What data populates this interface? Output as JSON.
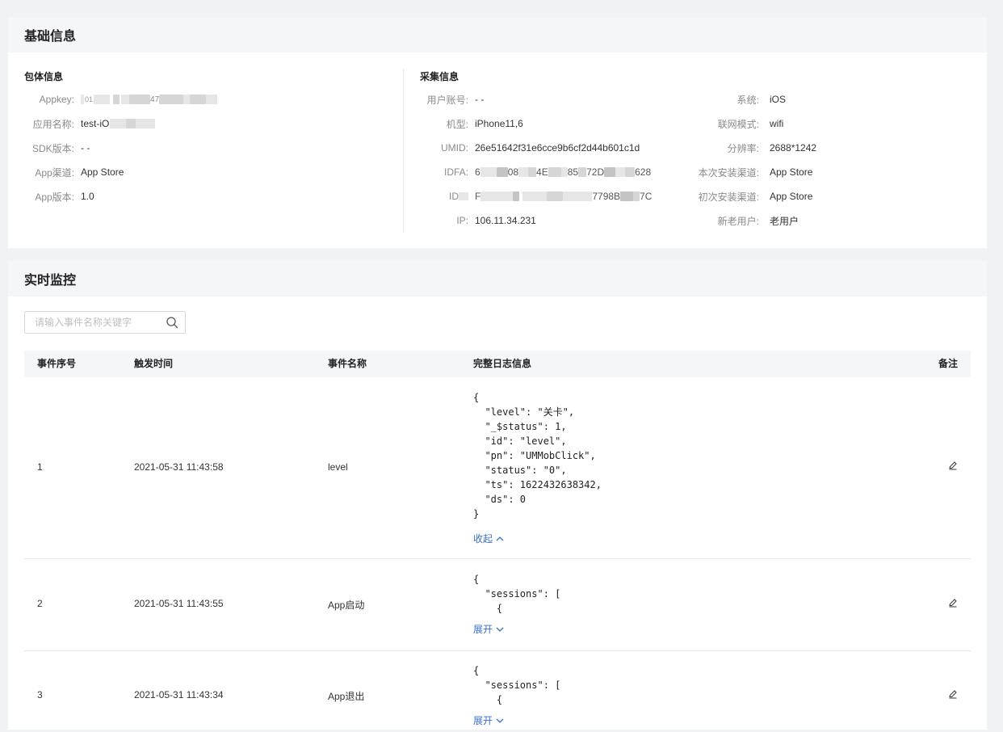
{
  "basic": {
    "title": "基础信息",
    "package": {
      "title": "包体信息",
      "rows": [
        {
          "label": "Appkey:",
          "value": ""
        },
        {
          "label": "应用名称:",
          "value": "test-iO"
        },
        {
          "label": "SDK版本:",
          "value": "- -"
        },
        {
          "label": "App渠道:",
          "value": "App Store"
        },
        {
          "label": "App版本:",
          "value": "1.0"
        }
      ]
    },
    "collect": {
      "title": "采集信息",
      "left": [
        {
          "label": "用户账号:",
          "value": "- -"
        },
        {
          "label": "机型:",
          "value": "iPhone11,6"
        },
        {
          "label": "UMID:",
          "value": "26e51642f31e6cce9b6cf2d44b601c1d"
        },
        {
          "label": "IDFA:",
          "value": ""
        },
        {
          "label": "ID",
          "value": ""
        },
        {
          "label": "IP:",
          "value": "106.11.34.231"
        }
      ],
      "right": [
        {
          "label": "系统:",
          "value": "iOS"
        },
        {
          "label": "联网模式:",
          "value": "wifi"
        },
        {
          "label": "分辨率:",
          "value": "2688*1242"
        },
        {
          "label": "本次安装渠道:",
          "value": "App Store"
        },
        {
          "label": "初次安装渠道:",
          "value": "App Store"
        },
        {
          "label": "新老用户:",
          "value": "老用户"
        }
      ]
    }
  },
  "monitor": {
    "title": "实时监控",
    "search_placeholder": "请输入事件名称关键字",
    "columns": [
      "事件序号",
      "触发时间",
      "事件名称",
      "完整日志信息",
      "备注"
    ],
    "rows": [
      {
        "index": "1",
        "time": "2021-05-31 11:43:58",
        "name": "level",
        "log": "{\n  \"level\": \"关卡\",\n  \"_$status\": 1,\n  \"id\": \"level\",\n  \"pn\": \"UMMobClick\",\n  \"status\": \"0\",\n  \"ts\": 1622432638342,\n  \"ds\": 0\n}",
        "toggle": "收起"
      },
      {
        "index": "2",
        "time": "2021-05-31 11:43:55",
        "name": "App启动",
        "log": "{\n  \"sessions\": [\n    {",
        "toggle": "展开"
      },
      {
        "index": "3",
        "time": "2021-05-31 11:43:34",
        "name": "App退出",
        "log": "{\n  \"sessions\": [\n    {",
        "toggle": "展开"
      }
    ]
  }
}
